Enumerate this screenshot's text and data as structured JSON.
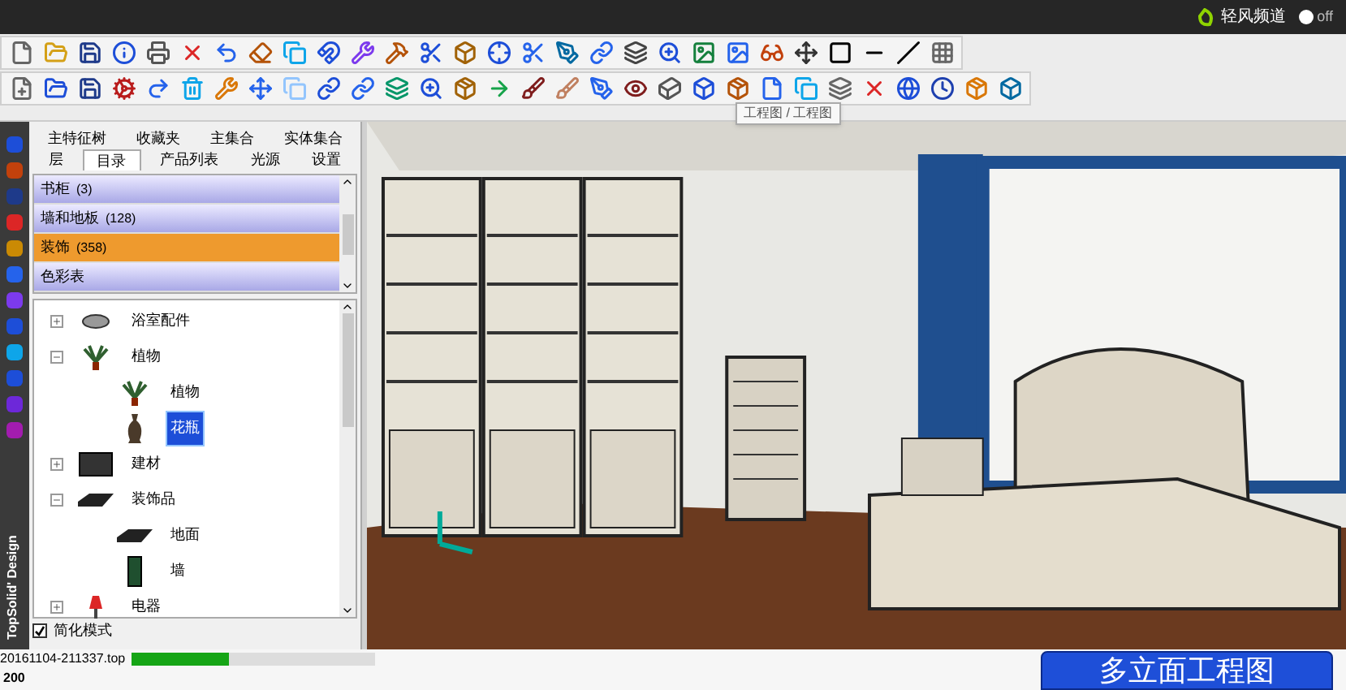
{
  "top_bar": {
    "channel_label": "轻风频道",
    "toggle": {
      "label": "off",
      "on": false
    }
  },
  "tooltip": "工程图 / 工程图",
  "side_strip": {
    "brand": "TopSolid' Design"
  },
  "tabs_row_1": [
    {
      "label": "主特征树",
      "selected": false
    },
    {
      "label": "收藏夹",
      "selected": false
    },
    {
      "label": "主集合",
      "selected": false
    },
    {
      "label": "实体集合",
      "selected": false
    }
  ],
  "tabs_row_2": [
    {
      "label": "层",
      "selected": false
    },
    {
      "label": "目录",
      "selected": true
    },
    {
      "label": "产品列表",
      "selected": false
    },
    {
      "label": "光源",
      "selected": false
    },
    {
      "label": "设置",
      "selected": false
    }
  ],
  "categories": [
    {
      "name": "书柜",
      "count": "(3)",
      "selected": false
    },
    {
      "name": "墙和地板",
      "count": "(128)",
      "selected": false
    },
    {
      "name": "装饰",
      "count": "(358)",
      "selected": true
    },
    {
      "name": "色彩表",
      "selected": false
    }
  ],
  "tree": [
    {
      "label": "浴室配件",
      "kind": "basin",
      "expanded": false,
      "selected": false
    },
    {
      "label": "植物",
      "kind": "plant",
      "expanded": true,
      "selected": false,
      "children": [
        {
          "label": "植物",
          "kind": "plant",
          "selected": false
        },
        {
          "label": "花瓶",
          "kind": "vase",
          "selected": true
        }
      ]
    },
    {
      "label": "建材",
      "kind": "panel",
      "expanded": false,
      "selected": false
    },
    {
      "label": "装饰品",
      "kind": "slab",
      "expanded": true,
      "selected": false,
      "children": [
        {
          "label": "地面",
          "kind": "slab",
          "selected": false
        },
        {
          "label": "墙",
          "kind": "wall",
          "selected": false
        }
      ]
    },
    {
      "label": "电器",
      "kind": "lamp",
      "expanded": false,
      "selected": false
    }
  ],
  "simplified_mode": {
    "label": "简化模式",
    "checked": true
  },
  "status_bar": {
    "file": "20161104-211337.top",
    "progress": {
      "level": 0.4
    },
    "value": "200"
  },
  "caption": "多立面工程图"
}
